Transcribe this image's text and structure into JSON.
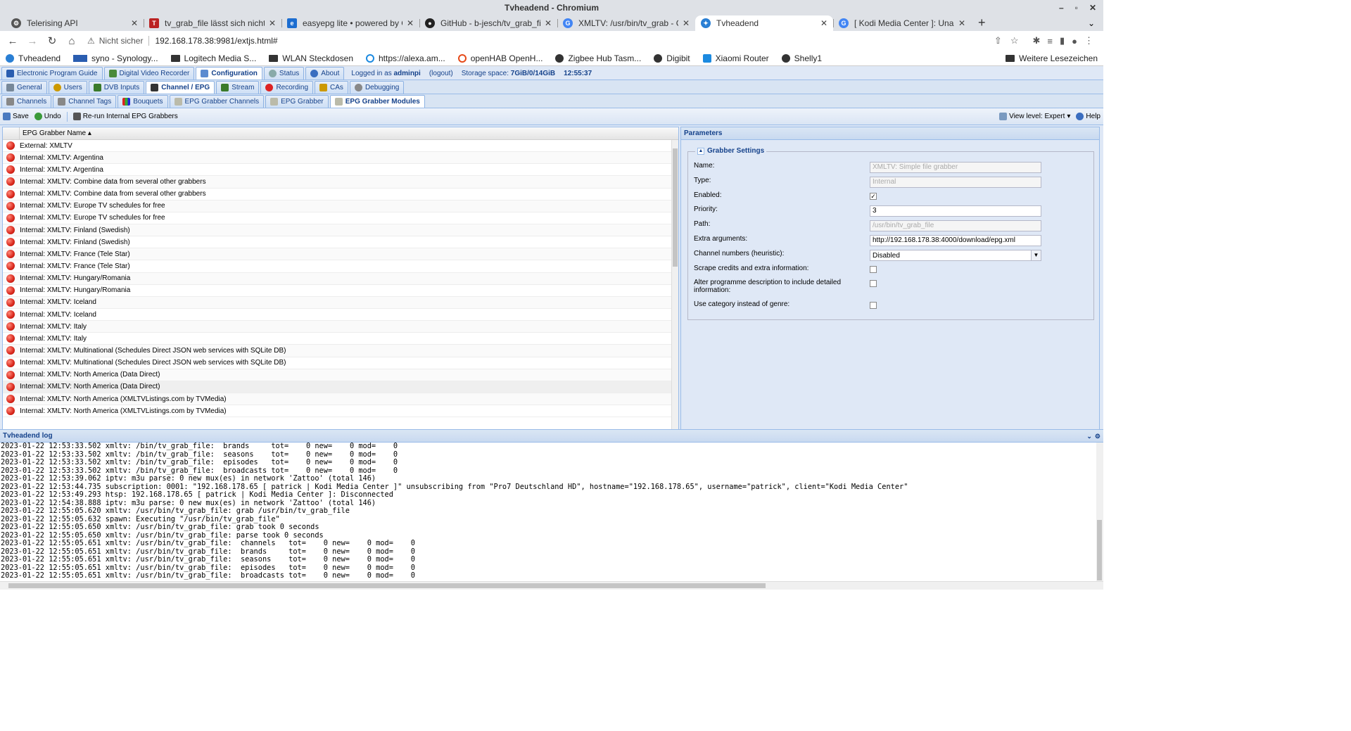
{
  "window": {
    "title": "Tvheadend - Chromium"
  },
  "tabs": [
    {
      "label": "Telerising API",
      "color": "#555"
    },
    {
      "label": "tv_grab_file lässt sich nicht al",
      "color": "#b22"
    },
    {
      "label": "easyepg lite • powered by Gra",
      "color": "#1c6dd0"
    },
    {
      "label": "GitHub - b-jesch/tv_grab_file:",
      "color": "#222"
    },
    {
      "label": "XMLTV: /usr/bin/tv_grab - Go",
      "color": "#4285f4"
    },
    {
      "label": "Tvheadend",
      "color": "#2a7fd4"
    },
    {
      "label": "[ Kodi Media Center ]: Unauth",
      "color": "#4285f4"
    }
  ],
  "address": {
    "security": "Nicht sicher",
    "url": "192.168.178.38:9981/extjs.html#"
  },
  "bookmarks": [
    "Tvheadend",
    "syno - Synology...",
    "Logitech Media S...",
    "WLAN Steckdosen",
    "https://alexa.am...",
    "openHAB OpenH...",
    "Zigbee Hub Tasm...",
    "Digibit",
    "Xiaomi Router",
    "Shelly1"
  ],
  "bookmarks_other": "Weitere Lesezeichen",
  "main_tabs": [
    "Electronic Program Guide",
    "Digital Video Recorder",
    "Configuration",
    "Status",
    "About"
  ],
  "status": {
    "logged_in": "Logged in as",
    "user": "adminpi",
    "logout": "(logout)",
    "storage_label": "Storage space:",
    "storage": "7GiB/0/14GiB",
    "time": "12:55:37"
  },
  "config_tabs": [
    "General",
    "Users",
    "DVB Inputs",
    "Channel / EPG",
    "Stream",
    "Recording",
    "CAs",
    "Debugging"
  ],
  "sub_tabs": [
    "Channels",
    "Channel Tags",
    "Bouquets",
    "EPG Grabber Channels",
    "EPG Grabber",
    "EPG Grabber Modules"
  ],
  "toolbar": {
    "save": "Save",
    "undo": "Undo",
    "rerun": "Re-run Internal EPG Grabbers",
    "view_level": "View level: Expert",
    "help": "Help"
  },
  "grid": {
    "header": "EPG Grabber Name ▴",
    "rows": [
      "External: XMLTV",
      "Internal: XMLTV: Argentina",
      "Internal: XMLTV: Argentina",
      "Internal: XMLTV: Combine data from several other grabbers",
      "Internal: XMLTV: Combine data from several other grabbers",
      "Internal: XMLTV: Europe TV schedules for free",
      "Internal: XMLTV: Europe TV schedules for free",
      "Internal: XMLTV: Finland (Swedish)",
      "Internal: XMLTV: Finland (Swedish)",
      "Internal: XMLTV: France (Tele Star)",
      "Internal: XMLTV: France (Tele Star)",
      "Internal: XMLTV: Hungary/Romania",
      "Internal: XMLTV: Hungary/Romania",
      "Internal: XMLTV: Iceland",
      "Internal: XMLTV: Iceland",
      "Internal: XMLTV: Italy",
      "Internal: XMLTV: Italy",
      "Internal: XMLTV: Multinational (Schedules Direct JSON web services with SQLite DB)",
      "Internal: XMLTV: Multinational (Schedules Direct JSON web services with SQLite DB)",
      "Internal: XMLTV: North America (Data Direct)",
      "Internal: XMLTV: North America (Data Direct)",
      "Internal: XMLTV: North America (XMLTVListings.com by TVMedia)",
      "Internal: XMLTV: North America (XMLTVListings.com by TVMedia)"
    ]
  },
  "params": {
    "title": "Parameters",
    "section": "Grabber Settings",
    "name_label": "Name:",
    "name_value": "XMLTV: Simple file grabber",
    "type_label": "Type:",
    "type_value": "Internal",
    "enabled_label": "Enabled:",
    "enabled_mark": "✓",
    "priority_label": "Priority:",
    "priority_value": "3",
    "path_label": "Path:",
    "path_value": "/usr/bin/tv_grab_file",
    "extra_label": "Extra arguments:",
    "extra_value": "http://192.168.178.38:4000/download/epg.xml",
    "channel_label": "Channel numbers (heuristic):",
    "channel_value": "Disabled",
    "scrape_label": "Scrape credits and extra information:",
    "alter_label": "Alter programme description to include detailed information:",
    "category_label": "Use category instead of genre:"
  },
  "log": {
    "title": "Tvheadend log",
    "lines": [
      "2023-01-22 12:53:33.502 xmltv: /bin/tv_grab_file:  brands     tot=    0 new=    0 mod=    0",
      "2023-01-22 12:53:33.502 xmltv: /bin/tv_grab_file:  seasons    tot=    0 new=    0 mod=    0",
      "2023-01-22 12:53:33.502 xmltv: /bin/tv_grab_file:  episodes   tot=    0 new=    0 mod=    0",
      "2023-01-22 12:53:33.502 xmltv: /bin/tv_grab_file:  broadcasts tot=    0 new=    0 mod=    0",
      "2023-01-22 12:53:39.062 iptv: m3u parse: 0 new mux(es) in network 'Zattoo' (total 146)",
      "2023-01-22 12:53:44.735 subscription: 0001: \"192.168.178.65 [ patrick | Kodi Media Center ]\" unsubscribing from \"Pro7 Deutschland HD\", hostname=\"192.168.178.65\", username=\"patrick\", client=\"Kodi Media Center\"",
      "2023-01-22 12:53:49.293 htsp: 192.168.178.65 [ patrick | Kodi Media Center ]: Disconnected",
      "2023-01-22 12:54:38.888 iptv: m3u parse: 0 new mux(es) in network 'Zattoo' (total 146)",
      "2023-01-22 12:55:05.620 xmltv: /usr/bin/tv_grab_file: grab /usr/bin/tv_grab_file",
      "2023-01-22 12:55:05.632 spawn: Executing \"/usr/bin/tv_grab_file\"",
      "2023-01-22 12:55:05.650 xmltv: /usr/bin/tv_grab_file: grab took 0 seconds",
      "2023-01-22 12:55:05.650 xmltv: /usr/bin/tv_grab_file: parse took 0 seconds",
      "2023-01-22 12:55:05.651 xmltv: /usr/bin/tv_grab_file:  channels   tot=    0 new=    0 mod=    0",
      "2023-01-22 12:55:05.651 xmltv: /usr/bin/tv_grab_file:  brands     tot=    0 new=    0 mod=    0",
      "2023-01-22 12:55:05.651 xmltv: /usr/bin/tv_grab_file:  seasons    tot=    0 new=    0 mod=    0",
      "2023-01-22 12:55:05.651 xmltv: /usr/bin/tv_grab_file:  episodes   tot=    0 new=    0 mod=    0",
      "2023-01-22 12:55:05.651 xmltv: /usr/bin/tv_grab_file:  broadcasts tot=    0 new=    0 mod=    0"
    ]
  }
}
